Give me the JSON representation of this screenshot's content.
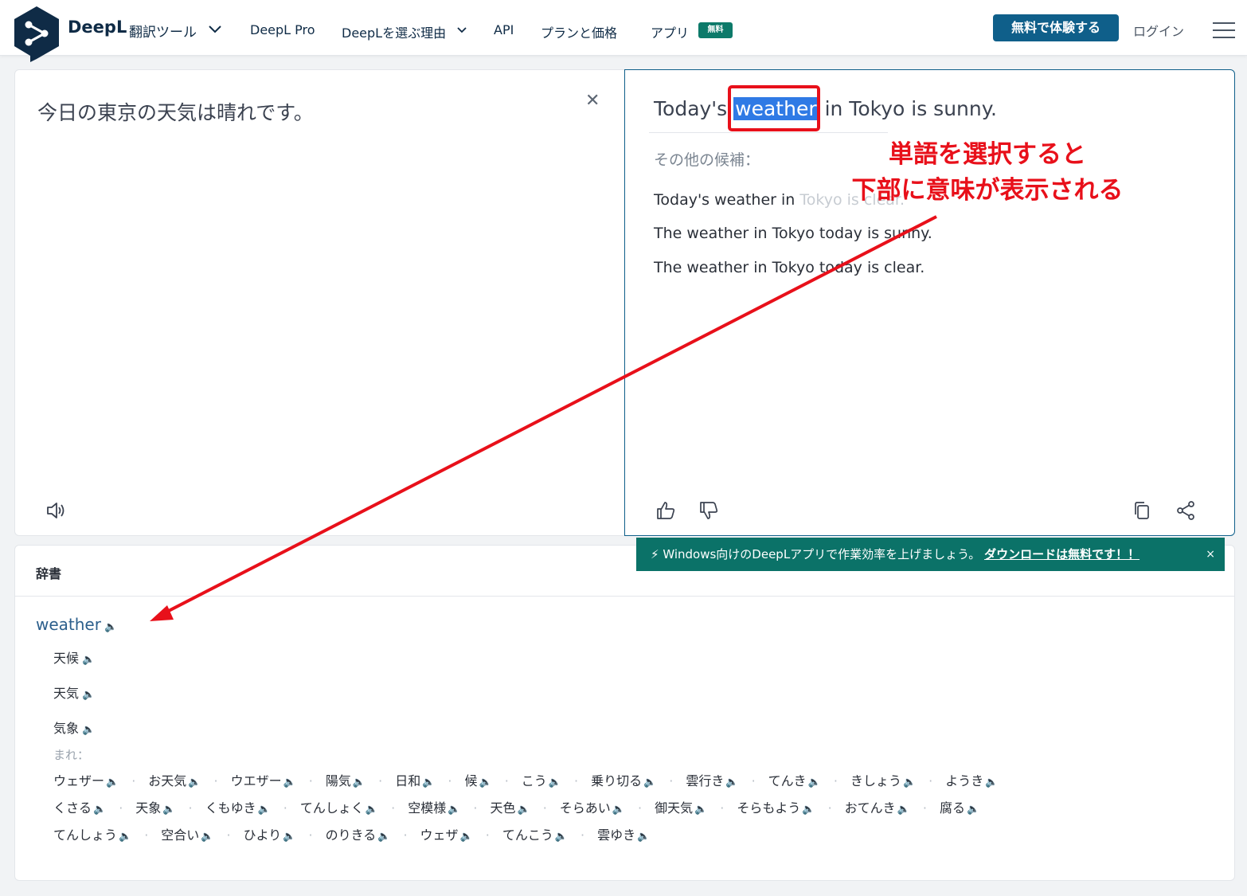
{
  "header": {
    "brand": "DeepL",
    "brand_sub": "翻訳ツール",
    "nav": [
      "DeepL Pro",
      "DeepLを選ぶ理由",
      "API",
      "プランと価格",
      "アプリ"
    ],
    "badge": "無料",
    "trial_button": "無料で体験する",
    "login": "ログイン"
  },
  "source": {
    "text": "今日の東京の天気は晴れです。"
  },
  "target": {
    "before": "Today's ",
    "highlight": "weather",
    "after": " in Tokyo is sunny.",
    "alt_label": "その他の候補：",
    "alt1_main": "Today's weather in ",
    "alt1_faded": "Tokyo is clear.",
    "alt2": "The weather in Tokyo today is sunny.",
    "alt3": "The weather in Tokyo today is clear."
  },
  "annotation": {
    "line1": "単語を選択すると",
    "line2": "下部に意味が表示される",
    "color": "#e8101a"
  },
  "banner": {
    "text": "Windows向けのDeepLアプリで作業効率を上げましょう。",
    "link": "ダウンロードは無料です！！",
    "close": "×"
  },
  "dictionary": {
    "title": "辞書",
    "headword": "weather",
    "senses": [
      "天候",
      "天気",
      "気象"
    ],
    "also_label": "まれ：",
    "synonyms_row1": [
      "ウェザー",
      "お天気",
      "ウエザー",
      "陽気",
      "日和",
      "候",
      "こう",
      "乗り切る",
      "雲行き",
      "てんき",
      "きしょう",
      "ようき"
    ],
    "synonyms_row2": [
      "くさる",
      "天象",
      "くもゆき",
      "てんしょく",
      "空模様",
      "天色",
      "そらあい",
      "御天気",
      "そらもよう",
      "おてんき",
      "腐る"
    ],
    "synonyms_row3": [
      "てんしょう",
      "空合い",
      "ひより",
      "のりきる",
      "ウェザ",
      "てんこう",
      "雲ゆき"
    ]
  },
  "colors": {
    "brand_navy": "#0f2b46",
    "trial_button": "#0f5f8a",
    "highlight": "#2f7ae5",
    "banner": "#0b7268"
  }
}
